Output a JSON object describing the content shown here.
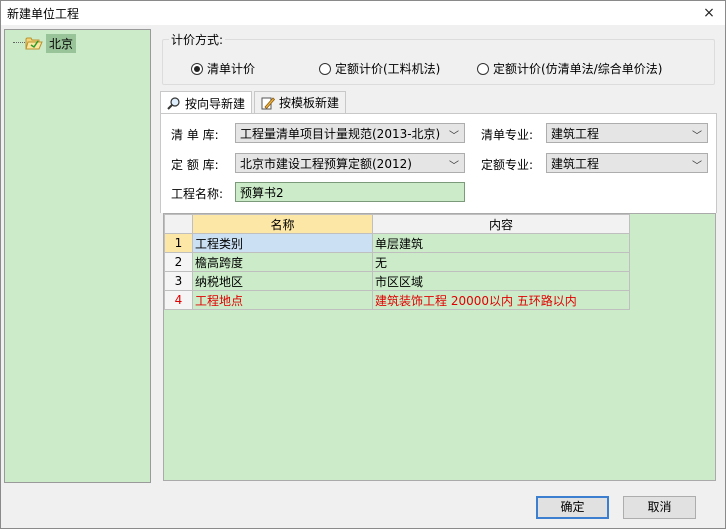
{
  "window": {
    "title": "新建单位工程",
    "close_icon": "×"
  },
  "tree": {
    "items": [
      {
        "label": "北京"
      }
    ]
  },
  "pricing": {
    "group_title": "计价方式:",
    "options": [
      {
        "label": "清单计价",
        "selected": true
      },
      {
        "label": "定额计价(工料机法)",
        "selected": false
      },
      {
        "label": "定额计价(仿清单法/综合单价法)",
        "selected": false
      }
    ]
  },
  "tabs": [
    {
      "label": "按向导新建",
      "active": true
    },
    {
      "label": "按模板新建",
      "active": false
    }
  ],
  "form": {
    "list_lib_label": "清 单 库:",
    "list_lib_value": "工程量清单项目计量规范(2013-北京)",
    "list_major_label": "清单专业:",
    "list_major_value": "建筑工程",
    "quota_lib_label": "定 额 库:",
    "quota_lib_value": "北京市建设工程预算定额(2012)",
    "quota_major_label": "定额专业:",
    "quota_major_value": "建筑工程",
    "project_name_label": "工程名称:",
    "project_name_value": "预算书2"
  },
  "grid": {
    "columns": [
      "名称",
      "内容"
    ],
    "rows": [
      {
        "num": "1",
        "name": "工程类别",
        "content": "单层建筑",
        "required": false
      },
      {
        "num": "2",
        "name": "檐高跨度",
        "content": "无",
        "required": false
      },
      {
        "num": "3",
        "name": "纳税地区",
        "content": "市区区域",
        "required": false
      },
      {
        "num": "4",
        "name": "工程地点",
        "content": "建筑装饰工程 20000以内 五环路以内",
        "required": true
      }
    ]
  },
  "footer": {
    "ok_label": "确定",
    "cancel_label": "取消"
  },
  "colors": {
    "panel_green": "#ccecc9",
    "required_red": "#e00000",
    "primary_border": "#3c7fd1"
  }
}
